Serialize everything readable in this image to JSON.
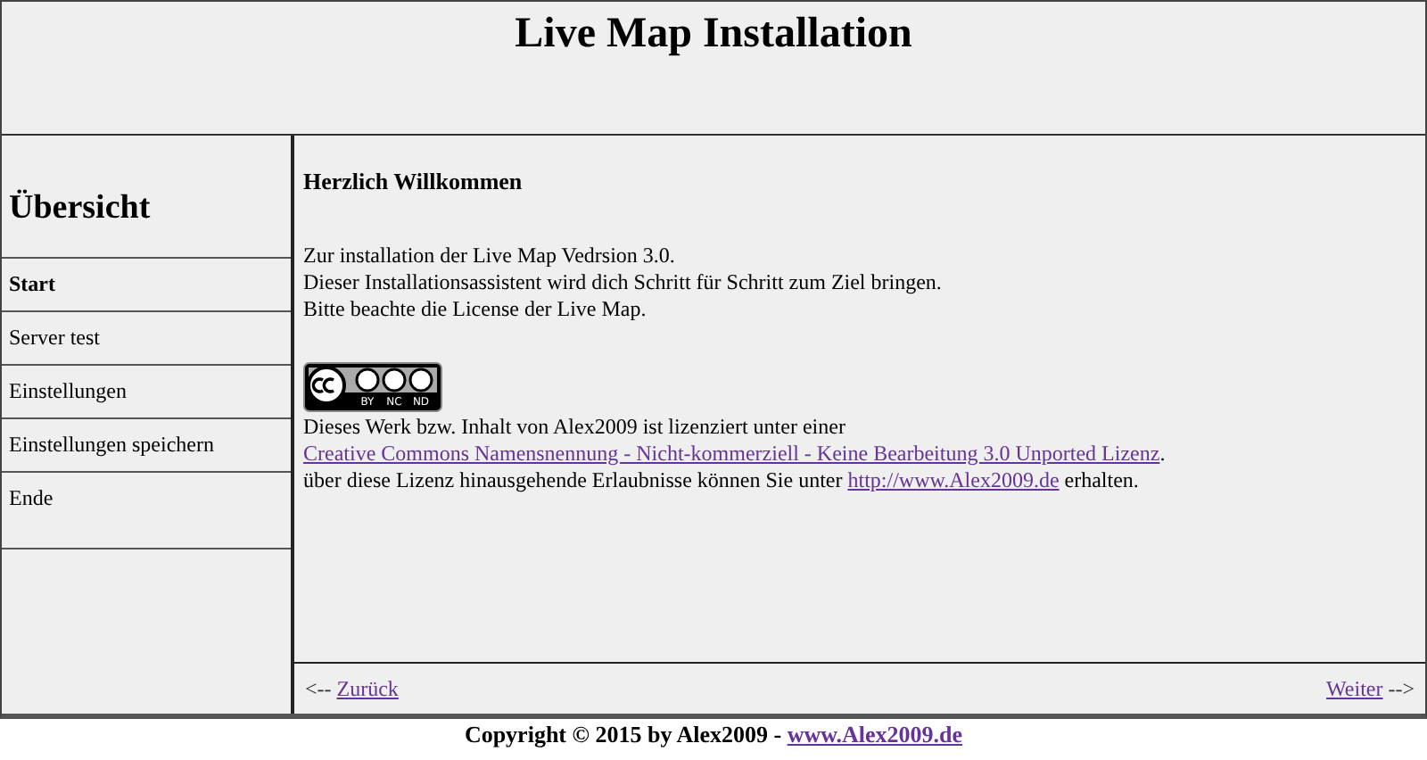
{
  "header": {
    "title": "Live Map Installation"
  },
  "sidebar": {
    "heading": "Übersicht",
    "items": [
      {
        "label": "Start",
        "selected": true
      },
      {
        "label": "Server test",
        "selected": false
      },
      {
        "label": "Einstellungen",
        "selected": false
      },
      {
        "label": "Einstellungen speichern",
        "selected": false
      },
      {
        "label": "Ende",
        "selected": false
      }
    ]
  },
  "content": {
    "heading": "Herzlich Willkommen",
    "intro": [
      "Zur installation der Live Map Vedrsion 3.0.",
      "Dieser Installationsassistent wird dich Schritt für Schritt zum Ziel bringen.",
      "Bitte beachte die License der Live Map."
    ],
    "license": {
      "badge": [
        "BY",
        "NC",
        "ND"
      ],
      "line_1": "Dieses Werk bzw. Inhalt von Alex2009 ist lizenziert unter einer",
      "license_link": "Creative Commons Namensnennung - Nicht-kommerziell - Keine Bearbeitung 3.0 Unported Lizenz",
      "license_after": ".",
      "line_3_before": "über diese Lizenz hinausgehende Erlaubnisse können Sie unter",
      "line_3_link": "http://www.Alex2009.de",
      "line_3_after": "erhalten."
    }
  },
  "nav": {
    "back_arrow": "<--",
    "back": "Zurück",
    "next": "Weiter",
    "next_arrow": "-->"
  },
  "footer": {
    "text": "Copyright © 2015 by Alex2009 -",
    "link": "www.Alex2009.de"
  }
}
